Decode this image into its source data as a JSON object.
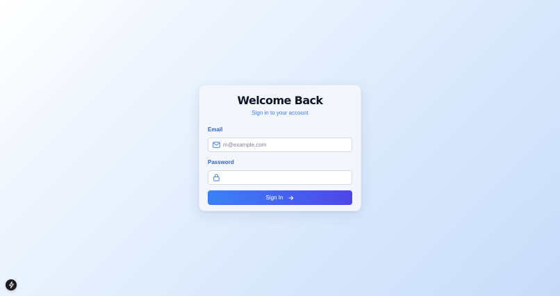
{
  "login": {
    "title": "Welcome Back",
    "subtitle": "Sign in to your account",
    "email": {
      "label": "Email",
      "placeholder": "m@example.com",
      "value": "",
      "icon": "mail-icon"
    },
    "password": {
      "label": "Password",
      "placeholder": "",
      "value": "",
      "icon": "lock-icon"
    },
    "submit": {
      "label": "Sign In",
      "icon": "arrow-right-icon"
    }
  },
  "badge": {
    "icon": "lightning-icon"
  },
  "colors": {
    "accent": "#3b82f6",
    "accent_end": "#4f46e5",
    "label_blue": "#2f62c9",
    "title": "#0f1626"
  }
}
